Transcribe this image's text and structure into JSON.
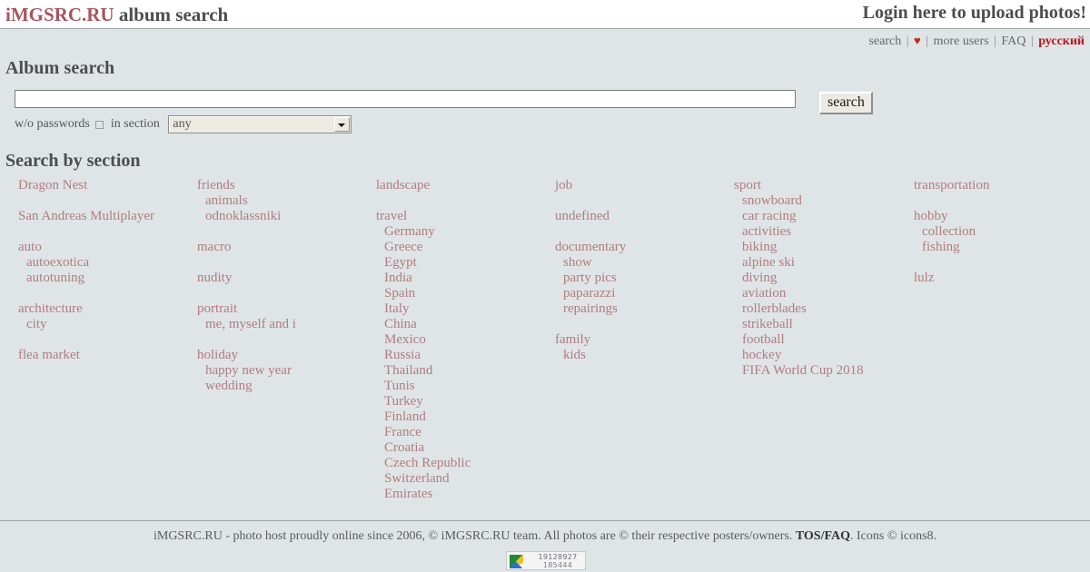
{
  "header": {
    "brand_site": "iMGSRC.RU",
    "brand_sub": "album search",
    "login_label": "Login here to upload photos!"
  },
  "nav": {
    "search_label": "search",
    "heart_icon": "♥",
    "more_users_label": "more users",
    "faq_label": "FAQ",
    "russian_label": "русский",
    "separator": "|"
  },
  "page": {
    "title": "Album search",
    "sections_title": "Search by section"
  },
  "search": {
    "query_value": "",
    "placeholder": "",
    "button_label": "search",
    "wo_passwords_label": "w/o passwords",
    "in_section_label": "in section",
    "section_selected": "any",
    "checkbox_checked": false
  },
  "columns": [
    {
      "groups": [
        {
          "top": "Dragon Nest",
          "subs": []
        },
        {
          "top": "San Andreas Multiplayer",
          "subs": []
        },
        {
          "top": "auto",
          "subs": [
            "autoexotica",
            "autotuning"
          ]
        },
        {
          "top": "architecture",
          "subs": [
            "city"
          ]
        },
        {
          "top": "flea market",
          "subs": []
        }
      ]
    },
    {
      "groups": [
        {
          "top": "friends",
          "subs": [
            "animals",
            "odnoklassniki"
          ]
        },
        {
          "top": "macro",
          "subs": []
        },
        {
          "top": "nudity",
          "subs": []
        },
        {
          "top": "portrait",
          "subs": [
            "me, myself and i"
          ]
        },
        {
          "top": "holiday",
          "subs": [
            "happy new year",
            "wedding"
          ]
        }
      ]
    },
    {
      "groups": [
        {
          "top": "landscape",
          "subs": []
        },
        {
          "top": "travel",
          "subs": [
            "Germany",
            "Greece",
            "Egypt",
            "India",
            "Spain",
            "Italy",
            "China",
            "Mexico",
            "Russia",
            "Thailand",
            "Tunis",
            "Turkey",
            "Finland",
            "France",
            "Croatia",
            "Czech Republic",
            "Switzerland",
            "Emirates"
          ]
        }
      ]
    },
    {
      "groups": [
        {
          "top": "job",
          "subs": []
        },
        {
          "top": "undefined",
          "subs": []
        },
        {
          "top": "documentary",
          "subs": [
            "show",
            "party pics",
            "paparazzi",
            "repairings"
          ]
        },
        {
          "top": "family",
          "subs": [
            "kids"
          ]
        }
      ]
    },
    {
      "groups": [
        {
          "top": "sport",
          "subs": [
            "snowboard",
            "car racing",
            "activities",
            "biking",
            "alpine ski",
            "diving",
            "aviation",
            "rollerblades",
            "strikeball",
            "football",
            "hockey",
            "FIFA World Cup 2018"
          ]
        }
      ]
    },
    {
      "groups": [
        {
          "top": "transportation",
          "subs": []
        },
        {
          "top": "hobby",
          "subs": [
            "collection",
            "fishing"
          ]
        },
        {
          "top": "lulz",
          "subs": []
        }
      ]
    }
  ],
  "footer": {
    "text_before": "iMGSRC.RU - photo host proudly online since 2006, © iMGSRC.RU team. All photos are © their respective posters/owners. ",
    "tos_label": "TOS/FAQ",
    "text_after": ". Icons © icons8."
  },
  "counter": {
    "total": "19128927",
    "today": "185444"
  },
  "colors": {
    "link": "#b07b84",
    "brand": "#a8545f",
    "russian": "#b81622",
    "heart": "#cc2222",
    "background": "#dfe5e7",
    "heading": "#4d4d4d"
  }
}
